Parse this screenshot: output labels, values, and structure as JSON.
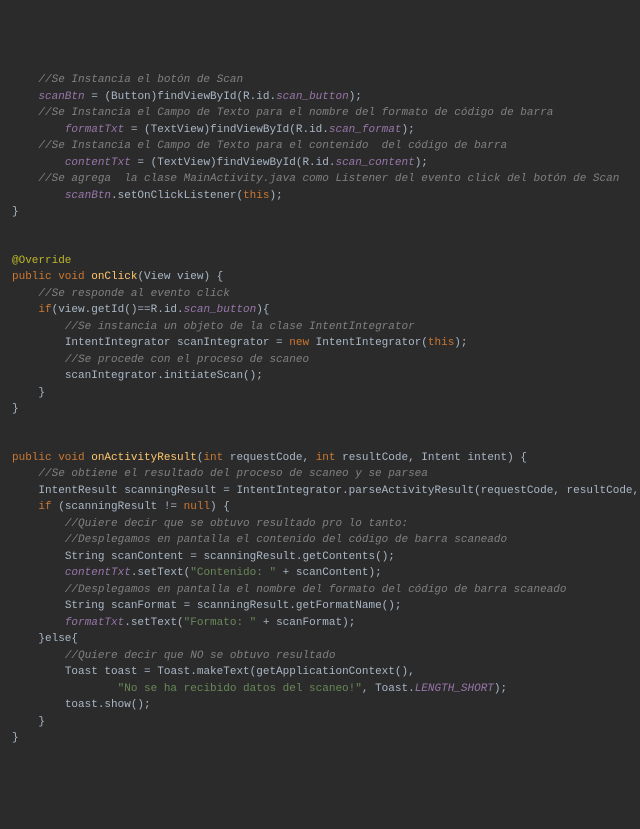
{
  "code": {
    "l1_comment": "//Se Instancia el botón de Scan",
    "l2_field": "scanBtn",
    "l2_cast": "(Button)findViewById(R.id.",
    "l2_id": "scan_button",
    "l2_end": ");",
    "l3_comment": "//Se Instancia el Campo de Texto para el nombre del formato de código de barra",
    "l4_field": "formatTxt",
    "l4_rhs": " = (TextView)findViewById(R.id.",
    "l4_id": "scan_format",
    "l4_end": ");",
    "l5_comment": "//Se Instancia el Campo de Texto para el contenido  del código de barra",
    "l6_field": "contentTxt",
    "l6_rhs": " = (TextView)findViewById(R.id.",
    "l6_id": "scan_content",
    "l6_end": ");",
    "l7_comment": "//Se agrega  la clase MainActivity.java como Listener del evento click del botón de Scan",
    "l8_field": "scanBtn",
    "l8_call": ".setOnClickListener(",
    "l8_this": "this",
    "l8_end": ");",
    "l9_brace": "}",
    "ann": "@Override",
    "m1_mods": "public void ",
    "m1_name": "onClick",
    "m1_params": "(View view) {",
    "m1c1": "//Se responde al evento click",
    "m1_if": "if",
    "m1_cond_a": "(view.getId()==R.id.",
    "m1_cond_id": "scan_button",
    "m1_cond_b": "){",
    "m1c2": "//Se instancia un objeto de la clase IntentIntegrator",
    "m1_type": "IntentIntegrator ",
    "m1_var": "scanIntegrator",
    "m1_eq": " = ",
    "m1_new": "new ",
    "m1_ctor": "IntentIntegrator(",
    "m1_this": "this",
    "m1_ctorend": ");",
    "m1c3": "//Se procede con el proceso de scaneo",
    "m1_call": "scanIntegrator.initiateScan();",
    "m1_cb": "}",
    "m1_cb2": "}",
    "m2_mods": "public void ",
    "m2_name": "onActivityResult",
    "m2_p_open": "(",
    "m2_int1": "int ",
    "m2_p1": "requestCode, ",
    "m2_int2": "int ",
    "m2_p2": "resultCode, Intent intent) {",
    "m2c1": "//Se obtiene el resultado del proceso de scaneo y se parsea",
    "m2_l1_type": "IntentResult ",
    "m2_l1_var": "scanningResult",
    "m2_l1_rhs": " = IntentIntegrator.parseActivityResult(requestCode, resultCode, intent);",
    "m2_if": "if ",
    "m2_cond_a": "(scanningResult != ",
    "m2_null": "null",
    "m2_cond_b": ") {",
    "m2c2": "//Quiere decir que se obtuvo resultado pro lo tanto:",
    "m2c3": "//Desplegamos en pantalla el contenido del código de barra scaneado",
    "m2_sc_type": "String ",
    "m2_sc_var": "scanContent",
    "m2_sc_rhs": " = scanningResult.getContents();",
    "m2_ct_field": "contentTxt",
    "m2_ct_call": ".setText(",
    "m2_ct_str": "\"Contenido: \"",
    "m2_ct_plus": " + scanContent);",
    "m2c4": "//Desplegamos en pantalla el nombre del formato del código de barra scaneado",
    "m2_sf_type": "String ",
    "m2_sf_var": "scanFormat",
    "m2_sf_rhs": " = scanningResult.getFormatName();",
    "m2_ft_field": "formatTxt",
    "m2_ft_call": ".setText(",
    "m2_ft_str": "\"Formato: \"",
    "m2_ft_plus": " + scanFormat);",
    "m2_else": "}else{",
    "m2c5": "//Quiere decir que NO se obtuvo resultado",
    "m2_toast_type": "Toast ",
    "m2_toast_var": "toast",
    "m2_toast_rhs": " = Toast.makeText(getApplicationContext(),",
    "m2_toast_str": "\"No se ha recibido datos del scaneo!\"",
    "m2_toast_mid": ", Toast.",
    "m2_toast_const": "LENGTH_SHORT",
    "m2_toast_end": ");",
    "m2_toast_show": "toast.show();",
    "m2_cb": "}",
    "m2_cb2": "}"
  }
}
